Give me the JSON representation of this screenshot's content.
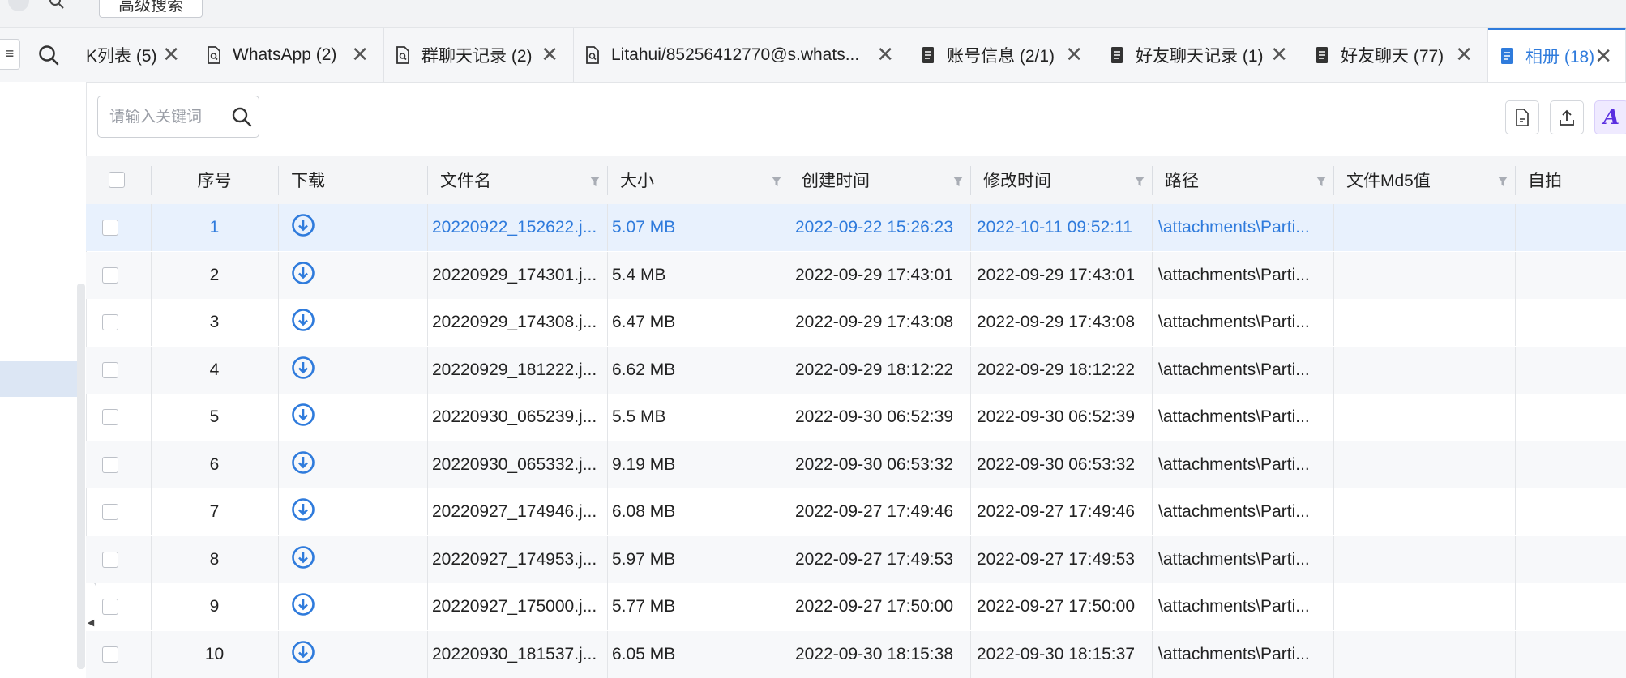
{
  "top": {
    "advanced_search_label": "高级搜索"
  },
  "tabs": [
    {
      "label": "K列表 (5)",
      "icon": "list-icon"
    },
    {
      "label": "WhatsApp (2)",
      "icon": "doc-search-icon"
    },
    {
      "label": "群聊天记录 (2)",
      "icon": "doc-search-icon"
    },
    {
      "label": "Litahui/85256412770@s.whats...",
      "icon": "doc-search-icon"
    },
    {
      "label": "账号信息 (2/1)",
      "icon": "document-icon"
    },
    {
      "label": "好友聊天记录 (1)",
      "icon": "document-icon"
    },
    {
      "label": "好友聊天 (77)",
      "icon": "document-icon"
    },
    {
      "label": "相册 (18)",
      "icon": "document-icon",
      "active": true
    }
  ],
  "toolbar": {
    "search_placeholder": "请输入关键词"
  },
  "colors": {
    "accent": "#2f7bdc",
    "selected_row": "#e8f1fd",
    "header_bg": "#f4f5f7"
  },
  "table": {
    "headers": [
      "序号",
      "下载",
      "文件名",
      "大小",
      "创建时间",
      "修改时间",
      "路径",
      "文件Md5值",
      "自拍"
    ],
    "rows": [
      {
        "idx": "1",
        "name": "20220922_152622.j...",
        "size": "5.07 MB",
        "created": "2022-09-22 15:26:23",
        "modified": "2022-10-11 09:52:11",
        "path": "\\attachments\\Parti...",
        "md5": "",
        "selfie": ""
      },
      {
        "idx": "2",
        "name": "20220929_174301.j...",
        "size": "5.4 MB",
        "created": "2022-09-29 17:43:01",
        "modified": "2022-09-29 17:43:01",
        "path": "\\attachments\\Parti...",
        "md5": "",
        "selfie": ""
      },
      {
        "idx": "3",
        "name": "20220929_174308.j...",
        "size": "6.47 MB",
        "created": "2022-09-29 17:43:08",
        "modified": "2022-09-29 17:43:08",
        "path": "\\attachments\\Parti...",
        "md5": "",
        "selfie": ""
      },
      {
        "idx": "4",
        "name": "20220929_181222.j...",
        "size": "6.62 MB",
        "created": "2022-09-29 18:12:22",
        "modified": "2022-09-29 18:12:22",
        "path": "\\attachments\\Parti...",
        "md5": "",
        "selfie": ""
      },
      {
        "idx": "5",
        "name": "20220930_065239.j...",
        "size": "5.5 MB",
        "created": "2022-09-30 06:52:39",
        "modified": "2022-09-30 06:52:39",
        "path": "\\attachments\\Parti...",
        "md5": "",
        "selfie": ""
      },
      {
        "idx": "6",
        "name": "20220930_065332.j...",
        "size": "9.19 MB",
        "created": "2022-09-30 06:53:32",
        "modified": "2022-09-30 06:53:32",
        "path": "\\attachments\\Parti...",
        "md5": "",
        "selfie": ""
      },
      {
        "idx": "7",
        "name": "20220927_174946.j...",
        "size": "6.08 MB",
        "created": "2022-09-27 17:49:46",
        "modified": "2022-09-27 17:49:46",
        "path": "\\attachments\\Parti...",
        "md5": "",
        "selfie": ""
      },
      {
        "idx": "8",
        "name": "20220927_174953.j...",
        "size": "5.97 MB",
        "created": "2022-09-27 17:49:53",
        "modified": "2022-09-27 17:49:53",
        "path": "\\attachments\\Parti...",
        "md5": "",
        "selfie": ""
      },
      {
        "idx": "9",
        "name": "20220927_175000.j...",
        "size": "5.77 MB",
        "created": "2022-09-27 17:50:00",
        "modified": "2022-09-27 17:50:00",
        "path": "\\attachments\\Parti...",
        "md5": "",
        "selfie": ""
      },
      {
        "idx": "10",
        "name": "20220930_181537.j...",
        "size": "6.05 MB",
        "created": "2022-09-30 18:15:38",
        "modified": "2022-09-30 18:15:37",
        "path": "\\attachments\\Parti...",
        "md5": "",
        "selfie": ""
      }
    ]
  }
}
